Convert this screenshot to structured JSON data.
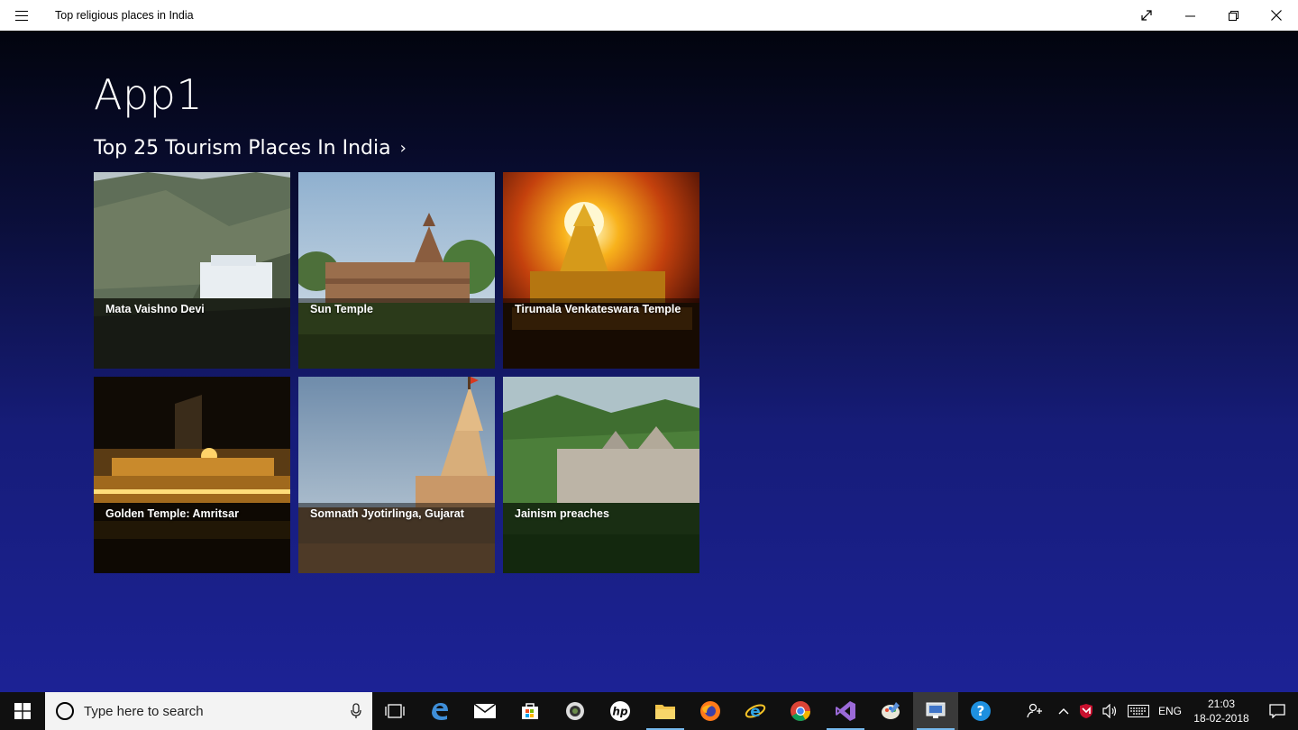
{
  "window": {
    "title": "Top religious places in India",
    "controls": [
      "expand-icon",
      "minimize-icon",
      "restore-icon",
      "close-icon"
    ]
  },
  "app": {
    "title": "App1",
    "section_title": "Top 25 Tourism Places In India",
    "section_chevron": "›"
  },
  "tiles": [
    {
      "label": "Mata Vaishno Devi"
    },
    {
      "label": "Sun Temple"
    },
    {
      "label": "Tirumala Venkateswara Temple"
    },
    {
      "label": "Golden Temple: Amritsar"
    },
    {
      "label": "Somnath Jyotirlinga, Gujarat"
    },
    {
      "label": "Jainism preaches"
    }
  ],
  "taskbar": {
    "search_placeholder": "Type here to search",
    "apps": [
      "task-view",
      "edge",
      "mail",
      "store",
      "camera",
      "hp",
      "file-explorer",
      "firefox",
      "internet-explorer",
      "chrome",
      "visual-studio",
      "paint",
      "app1",
      "help"
    ],
    "language": "ENG",
    "time": "21:03",
    "date": "18-02-2018"
  },
  "colors": {
    "background_top": "#02040e",
    "background_bottom": "#1c2295",
    "titlebar": "#ffffff",
    "taskbar": "#101010",
    "accent": "#76b9ed"
  }
}
